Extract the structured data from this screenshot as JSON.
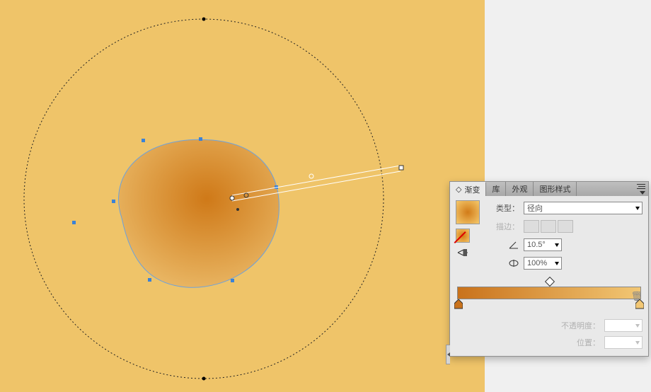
{
  "panel": {
    "tabs": [
      "渐变",
      "库",
      "外观",
      "图形样式"
    ],
    "active_tab": 0,
    "type_label": "类型：",
    "type_value": "径向",
    "stroke_label": "描边：",
    "angle_value": "10.5°",
    "aspect_value": "100%",
    "opacity_label": "不透明度：",
    "opacity_value": "",
    "position_label": "位置：",
    "position_value": "",
    "gradient_stops": [
      {
        "pos": 0,
        "color": "#c9721b"
      },
      {
        "pos": 100,
        "color": "#f2c774"
      }
    ]
  }
}
